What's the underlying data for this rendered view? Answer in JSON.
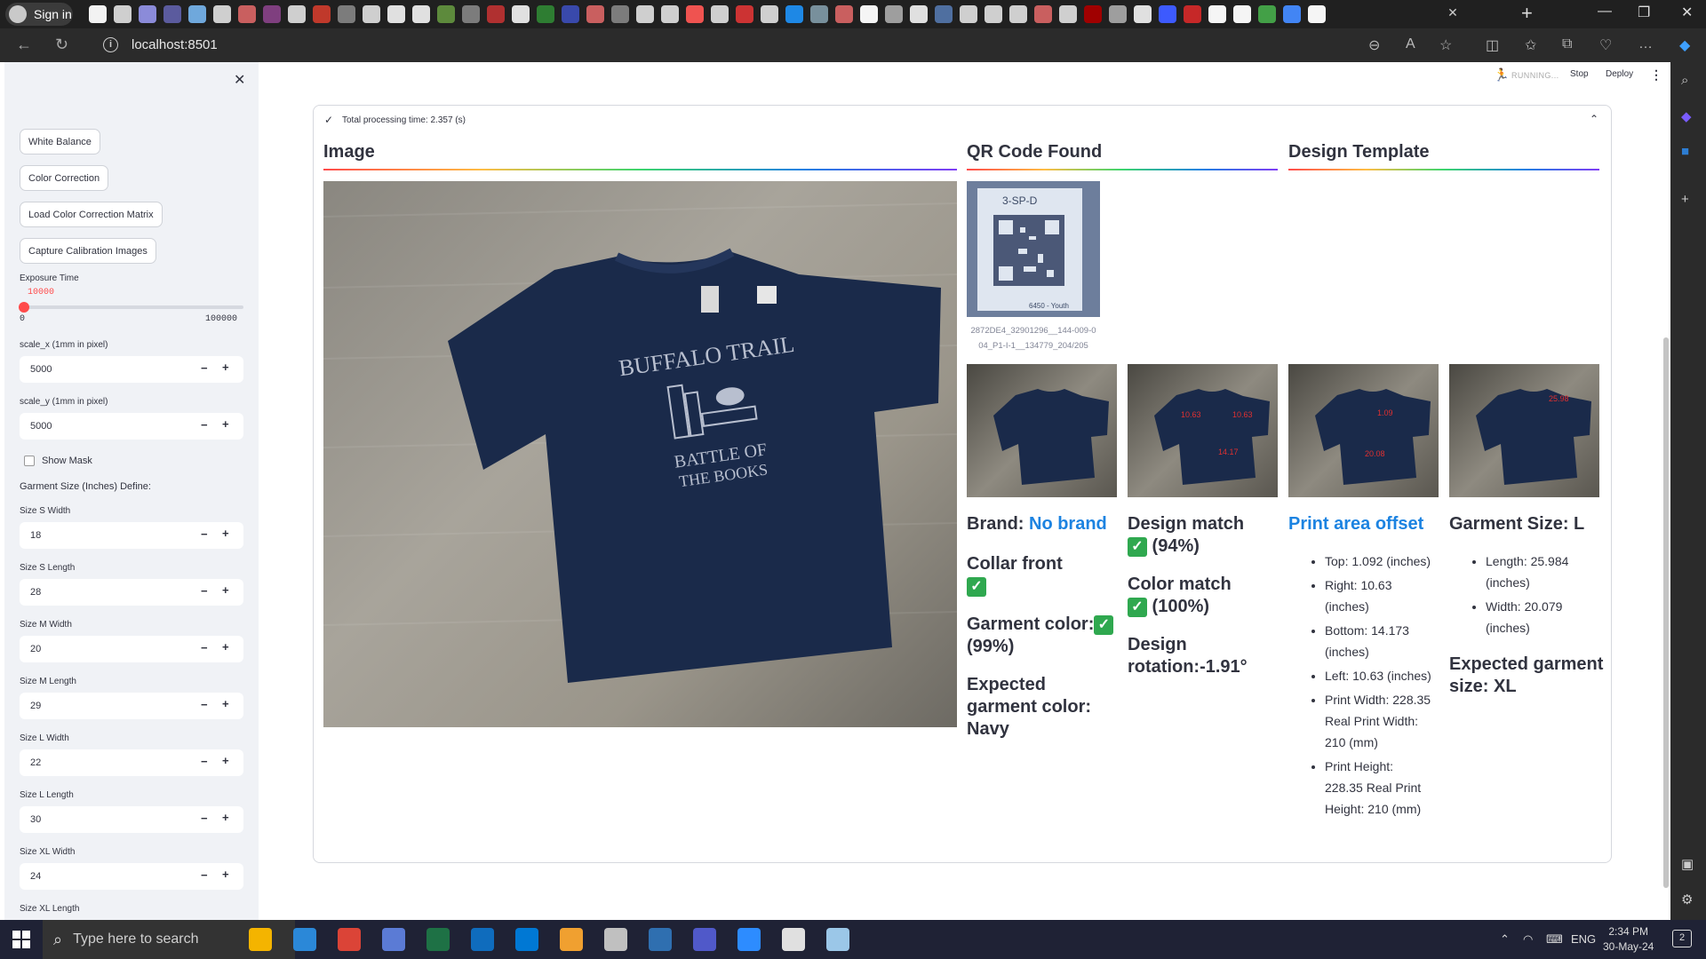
{
  "browser": {
    "profile_label": "Sign in",
    "url": "localhost:8501",
    "tab_icon_colors": [
      "#f2f2f2",
      "#cfcfcf",
      "#8b8bd9",
      "#5b5b9e",
      "#6fa8dc",
      "#cfcfcf",
      "#c95f5f",
      "#7f3f7f",
      "#cfcfcf",
      "#c0392b",
      "#7c7c7c",
      "#cfcfcf",
      "#e0e0e0",
      "#e0e0e0",
      "#5d8a3c",
      "#7c7c7c",
      "#b03030",
      "#e0e0e0",
      "#2e7d32",
      "#3949ab",
      "#c95f5f",
      "#7c7c7c",
      "#cfcfcf",
      "#cfcfcf",
      "#ef5350",
      "#cfcfcf",
      "#cc3333",
      "#cfcfcf",
      "#1e88e5",
      "#78909c",
      "#c95f5f",
      "#f5f5f5",
      "#9e9e9e",
      "#e0e0e0",
      "#4f6fa0",
      "#cfcfcf",
      "#cfcfcf",
      "#cfcfcf",
      "#c95f5f",
      "#cfcfcf",
      "#a00000",
      "#9e9e9e",
      "#e0e0e0",
      "#3d5afe",
      "#c62828",
      "#f5f5f5",
      "#f5f5f5",
      "#43a047",
      "#4285f4",
      "#f5f5f5"
    ]
  },
  "sidebar": {
    "buttons": [
      "White Balance",
      "Color Correction",
      "Load Color Correction Matrix",
      "Capture Calibration Images"
    ],
    "exposure": {
      "label": "Exposure Time",
      "value": "10000",
      "min": "0",
      "max": "100000",
      "fraction": 0.1
    },
    "scale_x": {
      "label": "scale_x (1mm in pixel)",
      "value": "5000"
    },
    "scale_y": {
      "label": "scale_y (1mm in pixel)",
      "value": "5000"
    },
    "show_mask_label": "Show Mask",
    "garment_size_title": "Garment Size (Inches) Define:",
    "sizes": [
      {
        "label": "Size S Width",
        "value": "18"
      },
      {
        "label": "Size S Length",
        "value": "28"
      },
      {
        "label": "Size M Width",
        "value": "20"
      },
      {
        "label": "Size M Length",
        "value": "29"
      },
      {
        "label": "Size L Width",
        "value": "22"
      },
      {
        "label": "Size L Length",
        "value": "30"
      },
      {
        "label": "Size XL Width",
        "value": "24"
      },
      {
        "label": "Size XL Length",
        "value": ""
      }
    ]
  },
  "header": {
    "status": "RUNNING...",
    "stop": "Stop",
    "deploy": "Deploy"
  },
  "main": {
    "processing_time": "Total processing time: 2.357 (s)",
    "columns": {
      "image": "Image",
      "qr": "QR Code Found",
      "template": "Design Template"
    },
    "qr_caption": "2872DE4_32901296__144-009-004_P1-I-1__134779_204/205",
    "qr_label_top": "3-SP-D",
    "qr_label_bottom": "6450 - Youth",
    "shirt_text_top": "BUFFALO TRAIL",
    "shirt_text_bottom_1": "BATTLE OF",
    "shirt_text_bottom_2": "THE BOOKS",
    "results": {
      "brand_label": "Brand: ",
      "brand_value": "No brand",
      "collar": "Collar front",
      "garment_color": "Garment color:",
      "garment_color_pct": "(99%)",
      "expected_color": "Expected garment color: Navy",
      "design_match": "Design match",
      "design_match_pct": " (94%)",
      "color_match": "Color match",
      "color_match_pct": " (100%)",
      "design_rotation": "Design rotation:-1.91°",
      "print_area_title": "Print area offset",
      "print_area": [
        "Top: 1.092 (inches)",
        "Right: 10.63 (inches)",
        "Bottom: 14.173 (inches)",
        "Left: 10.63 (inches)",
        "Print Width: 228.35 Real Print Width: 210 (mm)",
        "Print Height: 228.35 Real Print Height: 210 (mm)"
      ],
      "garment_size_title": "Garment Size: L",
      "garment_size_items": [
        "Length: 25.984 (inches)",
        "Width: 20.079 (inches)"
      ],
      "expected_size": "Expected garment size: XL",
      "thumb_overlays": {
        "t2": [
          "10.63",
          "10.63",
          "14.17"
        ],
        "t3": [
          "1.09",
          "20.08"
        ],
        "t4": [
          "25.98"
        ]
      }
    }
  },
  "taskbar": {
    "search_placeholder": "Type here to search",
    "language": "ENG",
    "time": "2:34 PM",
    "date": "30-May-24",
    "notifications": "2",
    "app_colors": [
      "#f4b400",
      "#2b88d8",
      "#db4437",
      "#5b7bd5",
      "#1e7145",
      "#0f6cbd",
      "#0078d4",
      "#f0a030",
      "#c0c0c0",
      "#2f6fb0",
      "#5059c9",
      "#2d8cff",
      "#e0e0e0",
      "#9bc7e8"
    ]
  }
}
